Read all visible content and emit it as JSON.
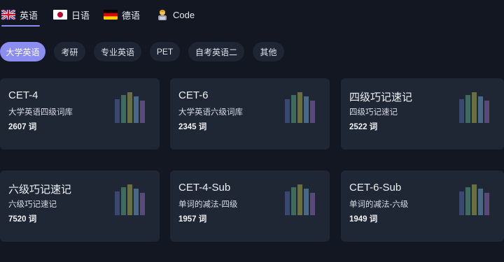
{
  "lang_tabs": [
    {
      "label": "英语",
      "flag": "uk-flag-icon",
      "active": true
    },
    {
      "label": "日语",
      "flag": "japan-flag-icon",
      "active": false
    },
    {
      "label": "德语",
      "flag": "germany-flag-icon",
      "active": false
    },
    {
      "label": "Code",
      "flag": "technologist-icon",
      "active": false
    }
  ],
  "categories": [
    {
      "label": "大学英语",
      "active": true
    },
    {
      "label": "考研",
      "active": false
    },
    {
      "label": "专业英语",
      "active": false
    },
    {
      "label": "PET",
      "active": false
    },
    {
      "label": "自考英语二",
      "active": false
    },
    {
      "label": "其他",
      "active": false
    }
  ],
  "cards": [
    {
      "title": "CET-4",
      "desc": "大学英语四级词库",
      "count": "2607 词"
    },
    {
      "title": "CET-6",
      "desc": "大学英语六级词库",
      "count": "2345 词"
    },
    {
      "title": "四级巧记速记",
      "desc": "四级巧记速记",
      "count": "2522 词"
    },
    {
      "title": "六级巧记速记",
      "desc": "六级巧记速记",
      "count": "7520 词"
    },
    {
      "title": "CET-4-Sub",
      "desc": "单词的减法-四级",
      "count": "1957 词"
    },
    {
      "title": "CET-6-Sub",
      "desc": "单词的减法-六级",
      "count": "1949 词"
    }
  ],
  "colors": {
    "accent": "#8b8df0",
    "background": "#121722",
    "card": "#1f2634",
    "book_colors": [
      "#3a4773",
      "#3f6b5e",
      "#6a6f3f",
      "#496a86",
      "#5a4a7a"
    ]
  }
}
